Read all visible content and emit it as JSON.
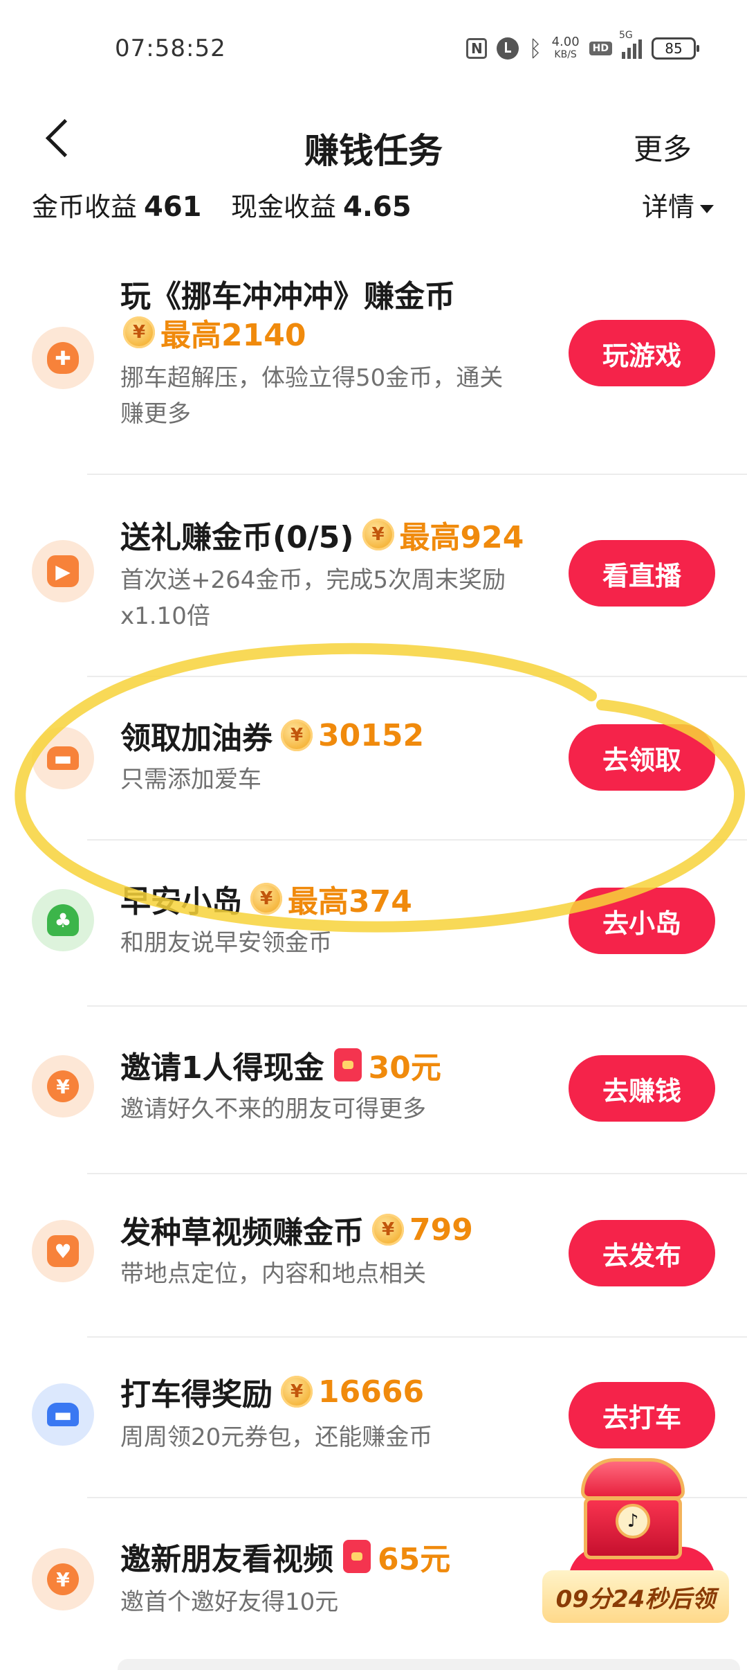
{
  "status_bar": {
    "time": "07:58:52",
    "net_speed": "4.00",
    "net_unit": "KB/S",
    "hd_label": "HD",
    "network": "5G",
    "battery": "85"
  },
  "nav": {
    "title": "赚钱任务",
    "more_label": "更多"
  },
  "summary": {
    "coin_label": "金币收益",
    "coin_value": "461",
    "cash_label": "现金收益",
    "cash_value": "4.65",
    "detail_label": "详情"
  },
  "tasks": [
    {
      "title": "玩《挪车冲冲冲》赚金币",
      "reward_type": "coin",
      "reward": "最高2140",
      "desc_line1": "挪车超解压，体验立得50金币，通关",
      "desc_line2": "赚更多",
      "button": "玩游戏",
      "icon": "gamepad-icon",
      "icon_color": "#f7823a"
    },
    {
      "title": "送礼赚金币(0/5)",
      "reward_type": "coin",
      "reward": "最高924",
      "desc_line1": "首次送+264金币，完成5次周末奖励",
      "desc_line2": "x1.10倍",
      "button": "看直播",
      "icon": "tv-icon",
      "icon_color": "#f7823a"
    },
    {
      "title": "领取加油券",
      "reward_type": "coin",
      "reward": "30152",
      "desc_line1": "只需添加爱车",
      "button": "去领取",
      "icon": "car-icon",
      "icon_color": "#f7823a"
    },
    {
      "title": "早安小岛",
      "reward_type": "coin",
      "reward": "最高374",
      "desc_line1": "和朋友说早安领金币",
      "button": "去小岛",
      "icon": "island-icon",
      "icon_color": "#3cb54a"
    },
    {
      "title": "邀请1人得现金",
      "reward_type": "redpacket",
      "reward": "30元",
      "desc_line1": "邀请好久不来的朋友可得更多",
      "button": "去赚钱",
      "icon": "yuan-coin-icon",
      "icon_color": "#f7823a"
    },
    {
      "title": "发种草视频赚金币",
      "reward_type": "coin",
      "reward": "799",
      "desc_line1": "带地点定位，内容和地点相关",
      "button": "去发布",
      "icon": "camera-icon",
      "icon_color": "#f7823a"
    },
    {
      "title": "打车得奖励",
      "reward_type": "coin",
      "reward": "16666",
      "desc_line1": "周周领20元券包，还能赚金币",
      "button": "去打车",
      "icon": "taxi-icon",
      "icon_color": "#3a78f2"
    },
    {
      "title": "邀新朋友看视频",
      "reward_type": "redpacket",
      "reward": "65元",
      "desc_line1": "邀首个邀好友得10元",
      "icon": "yuan-coin-icon",
      "icon_color": "#f7823a"
    }
  ],
  "coin_symbol": "¥",
  "chest": {
    "timer": "09分24秒后领",
    "icon": "treasure-chest-icon"
  },
  "colors": {
    "button": "#f5234a",
    "reward": "#f08a0c",
    "highlight_stroke": "#f7d23a"
  }
}
